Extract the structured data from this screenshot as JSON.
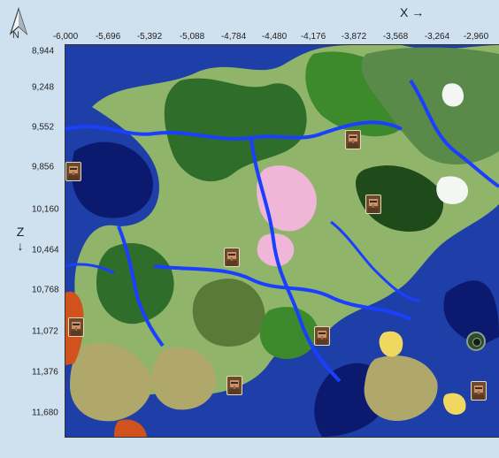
{
  "compass": {
    "label": "N",
    "icon": "north-arrow-icon"
  },
  "axes": {
    "x_title": "X →",
    "z_title_letter": "Z",
    "z_title_arrow": "↓",
    "x_ticks": [
      "-6,000",
      "-5,696",
      "-5,392",
      "-5,088",
      "-4,784",
      "-4,480",
      "-4,176",
      "-3,872",
      "-3,568",
      "-3,264",
      "-2,960"
    ],
    "z_ticks": [
      "8,944",
      "9,248",
      "9,552",
      "9,856",
      "10,160",
      "10,464",
      "10,768",
      "11,072",
      "11,376",
      "11,680"
    ]
  },
  "map": {
    "colors": {
      "deep_ocean": "#0b1a6e",
      "ocean": "#1f3fa8",
      "forest": "#2f6e2a",
      "dark_forest": "#1f4a1a",
      "plains": "#8fb46a",
      "savanna": "#b0a86a",
      "jungle": "#3c8a2c",
      "cherry": "#f0b6d8",
      "swamp": "#5a7a3a",
      "river": "#1a3fff",
      "beach": "#f0d860",
      "badlands": "#d2521e",
      "snow": "#f4f6f4"
    },
    "markers": [
      {
        "type": "village",
        "icon": "villager-icon",
        "x": -5942,
        "z": 9856
      },
      {
        "type": "village",
        "icon": "villager-icon",
        "x": -3872,
        "z": 9612
      },
      {
        "type": "village",
        "icon": "villager-icon",
        "x": -3720,
        "z": 10100
      },
      {
        "type": "village",
        "icon": "villager-icon",
        "x": -4770,
        "z": 10500
      },
      {
        "type": "village",
        "icon": "villager-icon",
        "x": -5922,
        "z": 11030
      },
      {
        "type": "village",
        "icon": "villager-icon",
        "x": -4100,
        "z": 11100
      },
      {
        "type": "village",
        "icon": "villager-icon",
        "x": -4750,
        "z": 11470
      },
      {
        "type": "village",
        "icon": "villager-icon",
        "x": -2940,
        "z": 11510
      },
      {
        "type": "stronghold",
        "icon": "ender-eye-icon",
        "x": -2960,
        "z": 11135
      }
    ]
  }
}
